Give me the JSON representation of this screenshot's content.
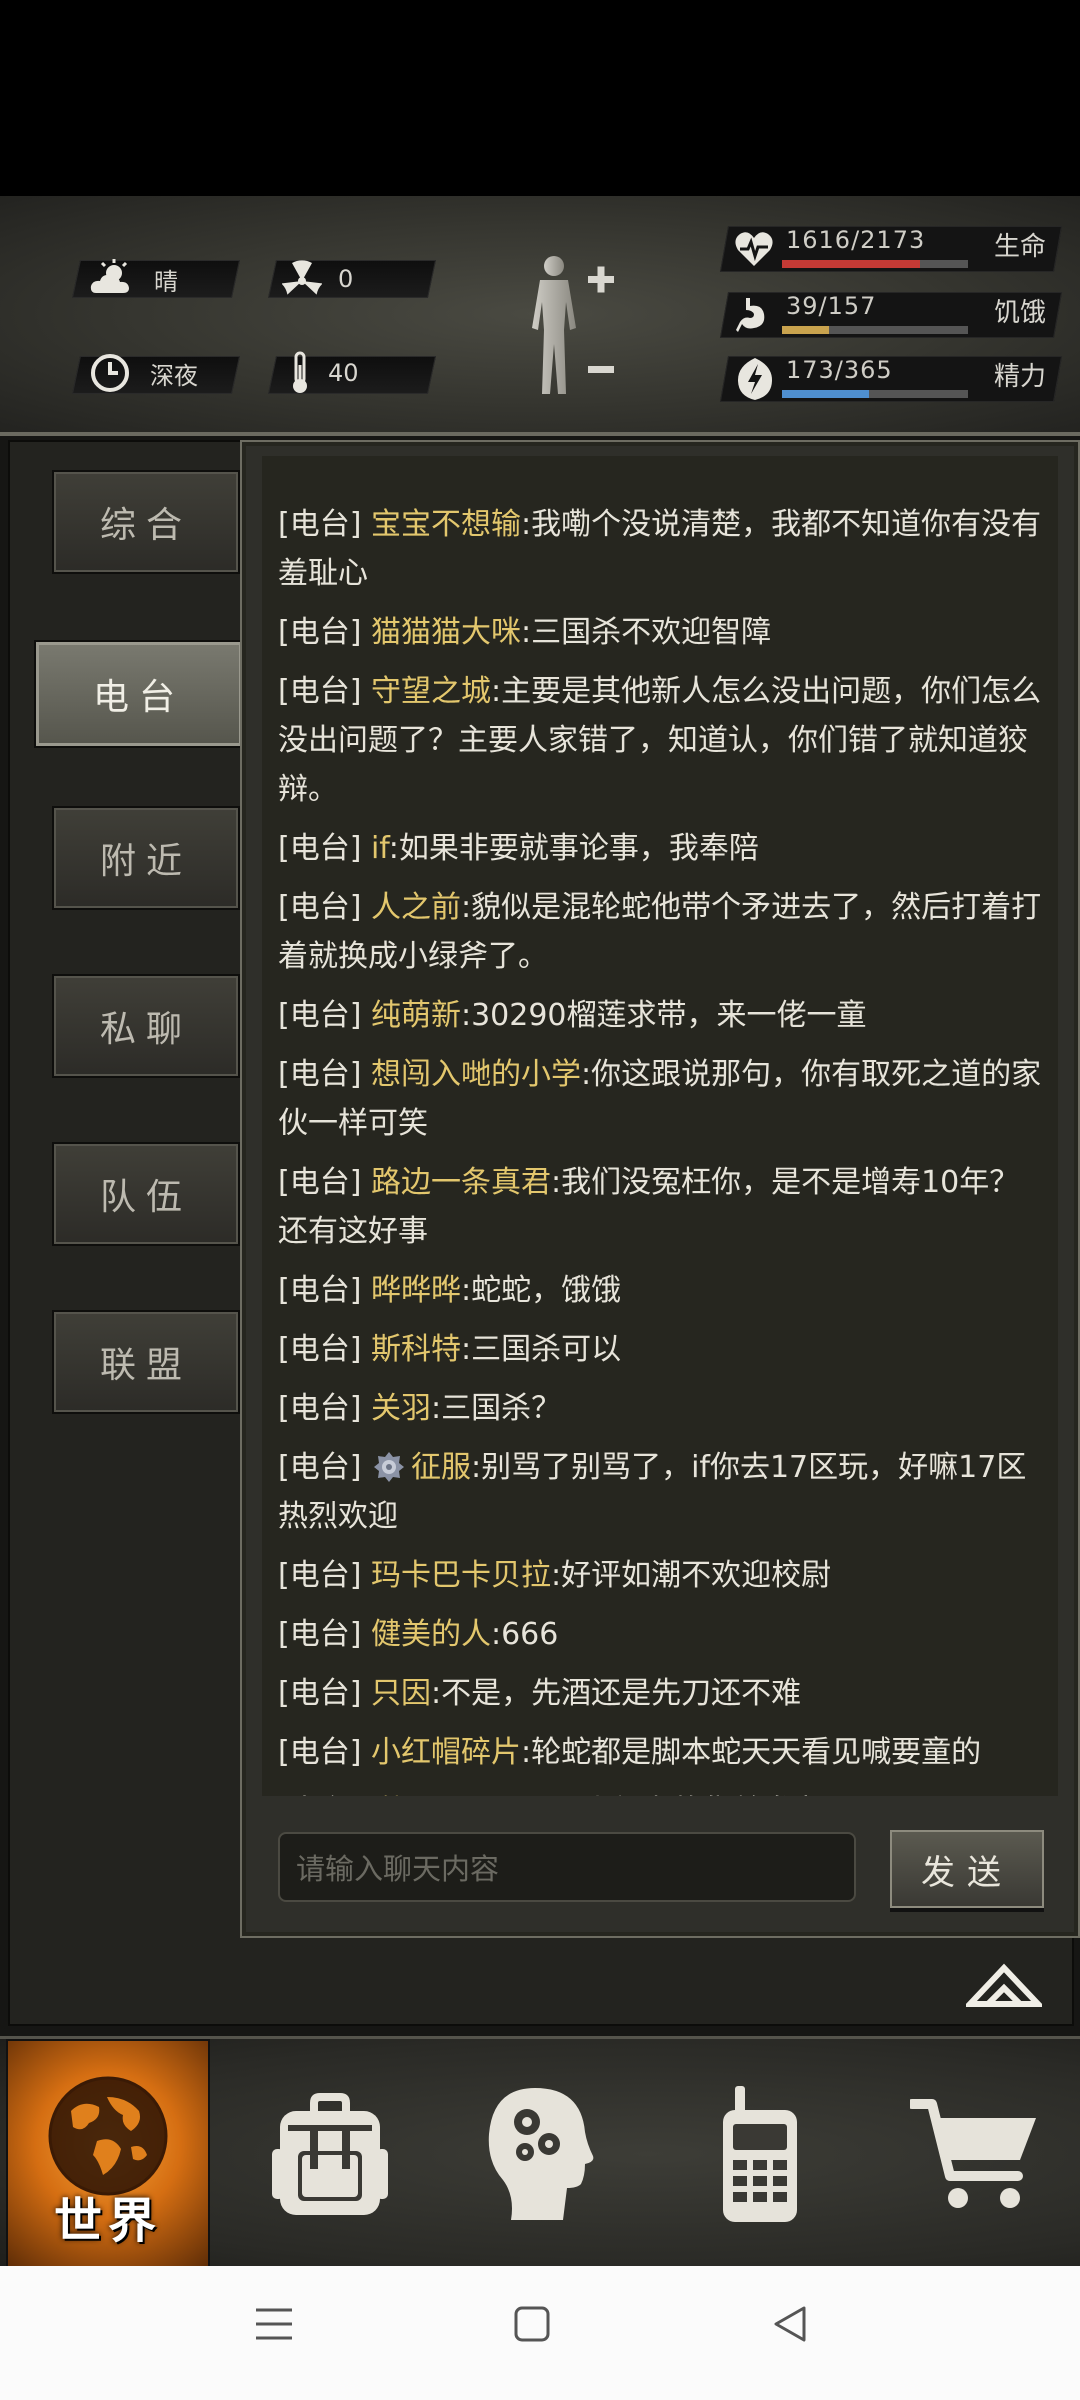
{
  "status": {
    "weather": "晴",
    "radiation": "0",
    "time_of_day": "深夜",
    "temperature": "40"
  },
  "vitals": [
    {
      "value": "1616/2173",
      "label": "生命",
      "icon": "heart-pulse-icon",
      "fraction": 0.74,
      "color": "#c43a35"
    },
    {
      "value": "39/157",
      "label": "饥饿",
      "icon": "stomach-icon",
      "fraction": 0.25,
      "color": "#c9a34e"
    },
    {
      "value": "173/365",
      "label": "精力",
      "icon": "energy-icon",
      "fraction": 0.47,
      "color": "#4f8fcf"
    }
  ],
  "tabs": [
    {
      "label": "综合",
      "active": false
    },
    {
      "label": "电台",
      "active": true
    },
    {
      "label": "附近",
      "active": false
    },
    {
      "label": "私聊",
      "active": false
    },
    {
      "label": "队伍",
      "active": false
    },
    {
      "label": "联盟",
      "active": false
    }
  ],
  "chat": {
    "tag": "[电台]",
    "messages": [
      {
        "name": "宝宝不想输",
        "text": ":我嘞个没说清楚，我都不知道你有没有羞耻心"
      },
      {
        "name": "猫猫猫大咪",
        "text": ":三国杀不欢迎智障"
      },
      {
        "name": "守望之城",
        "text": ":主要是其他新人怎么没出问题，你们怎么没出问题了？主要人家错了，知道认，你们错了就知道狡辩。"
      },
      {
        "name": "if",
        "text": ":如果非要就事论事，我奉陪"
      },
      {
        "name": "人之前",
        "text": ":貌似是混轮蛇他带个矛进去了，然后打着打着就换成小绿斧了。"
      },
      {
        "name": "纯萌新",
        "text": ":30290榴莲求带，来一佬一童"
      },
      {
        "name": "想闯入哋的小学",
        "text": ":你这跟说那句，你有取死之道的家伙一样可笑"
      },
      {
        "name": "路边一条真君",
        "text": ":我们没冤枉你，是不是增寿10年？还有这好事"
      },
      {
        "name": "晔晔晔",
        "text": ":蛇蛇，饿饿"
      },
      {
        "name": "斯科特",
        "text": ":三国杀可以"
      },
      {
        "name": "关羽",
        "text": ":三国杀？"
      },
      {
        "name": "征服",
        "text": ":别骂了别骂了，if你去17区玩，好嘛17区热烈欢迎",
        "badge": true
      },
      {
        "name": "玛卡巴卡贝拉",
        "text": ":好评如潮不欢迎校尉"
      },
      {
        "name": "健美的人",
        "text": ":666"
      },
      {
        "name": "只因",
        "text": ":不是，先酒还是先刀还不难"
      },
      {
        "name": "小红帽碎片",
        "text": ":轮蛇都是脚本蛇天天看见喊要童的"
      },
      {
        "name": "谢R",
        "text": ":ByD是不是小红书的集美发力了"
      }
    ],
    "input_placeholder": "请输入聊天内容",
    "send_label": "发送"
  },
  "bottom_nav": {
    "world_label": "世界",
    "items": [
      "globe-icon",
      "backpack-icon",
      "brain-head-icon",
      "walkie-talkie-icon",
      "shopping-cart-icon"
    ]
  }
}
